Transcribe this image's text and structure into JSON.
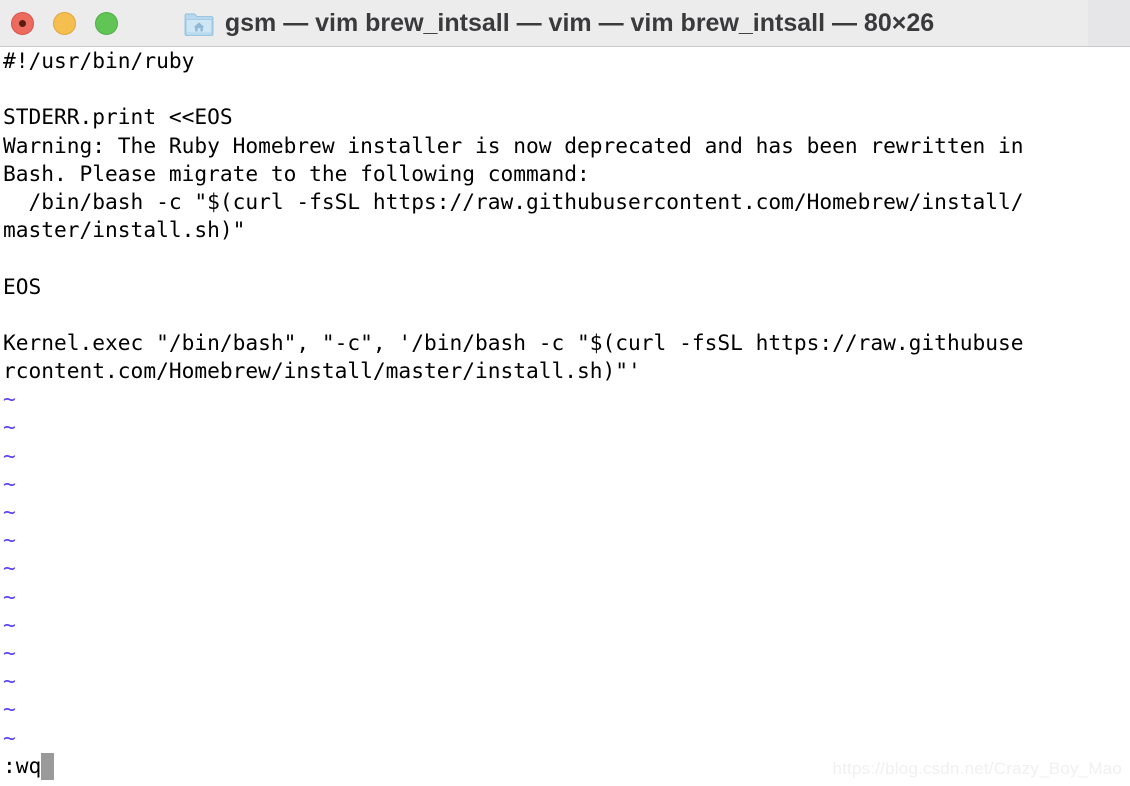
{
  "window": {
    "title": "gsm — vim brew_intsall — vim — vim brew_intsall — 80×26",
    "folder_icon_name": "folder-home-icon",
    "controls": {
      "close_label": "close",
      "minimize_label": "minimize",
      "maximize_label": "maximize"
    },
    "colors": {
      "titlebar_bg": "#ececed",
      "titlebar_border": "#c9c9cc",
      "title_text": "#3a3a3c",
      "close": "#ec6a5e",
      "minimize": "#f5bf4f",
      "maximize": "#61c555",
      "terminal_bg": "#ffffff",
      "terminal_fg": "#000000",
      "tilde_fg": "#5a43f0",
      "cursor_bg": "#9a9a9a",
      "watermark_fg": "#f0f0f0"
    }
  },
  "terminal": {
    "size_label": "80×26",
    "lines": [
      "#!/usr/bin/ruby",
      "",
      "STDERR.print <<EOS",
      "Warning: The Ruby Homebrew installer is now deprecated and has been rewritten in",
      "Bash. Please migrate to the following command:",
      "  /bin/bash -c \"$(curl -fsSL https://raw.githubusercontent.com/Homebrew/install/",
      "master/install.sh)\"",
      "",
      "EOS",
      "",
      "Kernel.exec \"/bin/bash\", \"-c\", '/bin/bash -c \"$(curl -fsSL https://raw.githubuse",
      "rcontent.com/Homebrew/install/master/install.sh)\"'"
    ],
    "empty_markers": [
      "~",
      "~",
      "~",
      "~",
      "~",
      "~",
      "~",
      "~",
      "~",
      "~",
      "~",
      "~",
      "~"
    ],
    "command_line": ":wq",
    "cursor": "block"
  },
  "watermark": {
    "text": "https://blog.csdn.net/Crazy_Boy_Mao"
  }
}
